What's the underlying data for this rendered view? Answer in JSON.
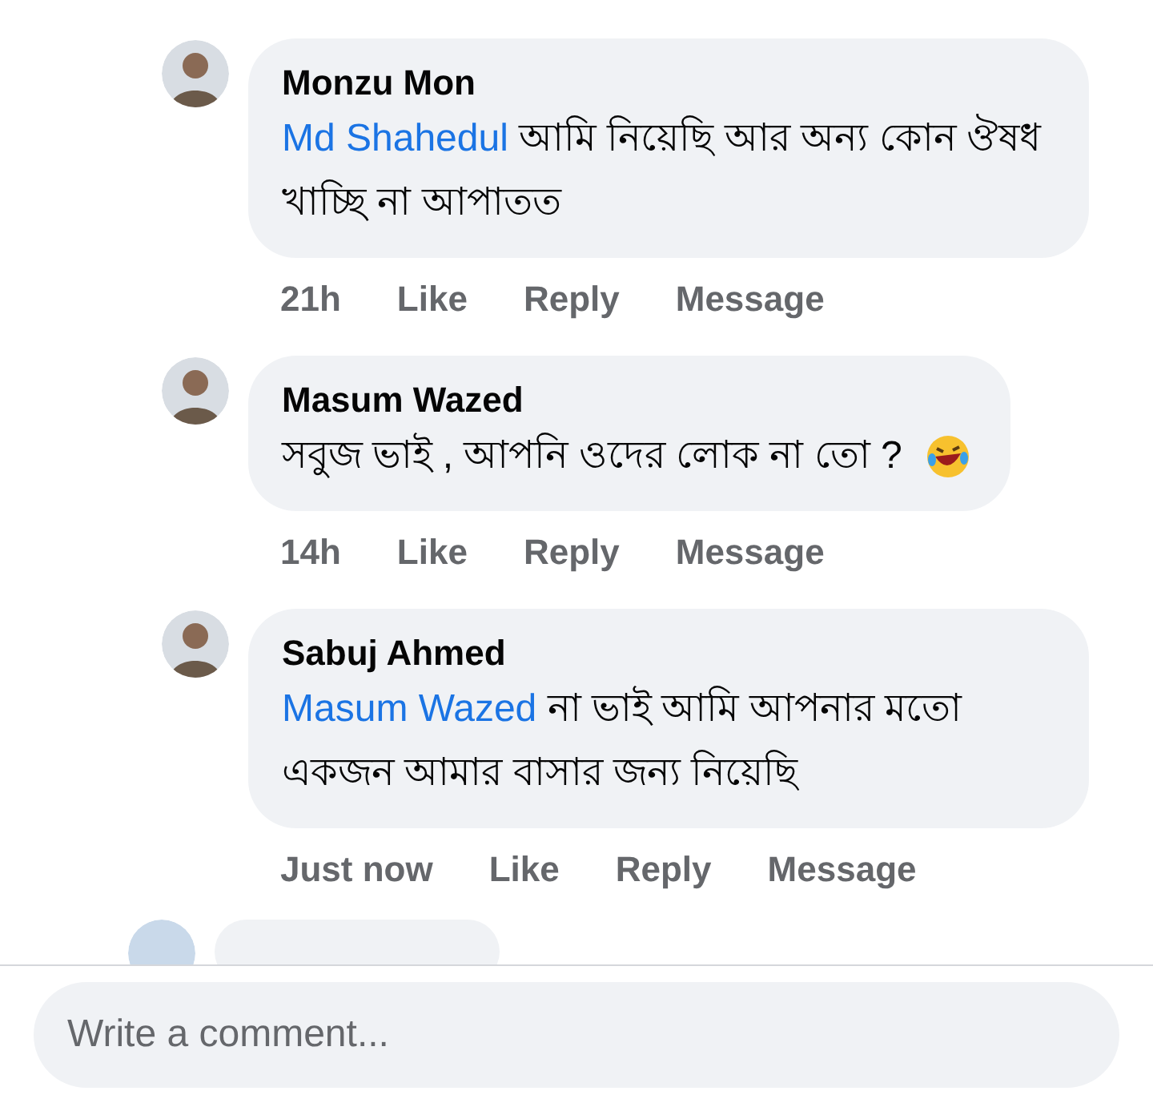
{
  "comments": [
    {
      "author": "Monzu Mon",
      "mention": "Md Shahedul",
      "text": "আমি নিয়েছি আর অন্য কোন ঔষধ খাচ্ছি না আপাতত",
      "emoji": false,
      "time": "21h",
      "actions": [
        "Like",
        "Reply",
        "Message"
      ]
    },
    {
      "author": "Masum Wazed",
      "text": "সবুজ ভাই , আপনি ওদের লোক না তো ?",
      "emoji": true,
      "time": "14h",
      "actions": [
        "Like",
        "Reply",
        "Message"
      ]
    },
    {
      "author": "Sabuj Ahmed",
      "mention": "Masum Wazed",
      "text": "না ভাই আমি আপনার মতো একজন আমার বাসার জন্য নিয়েছি",
      "emoji": false,
      "time": "Just now",
      "actions": [
        "Like",
        "Reply",
        "Message"
      ]
    }
  ],
  "comment_field": {
    "placeholder": "Write a comment..."
  }
}
